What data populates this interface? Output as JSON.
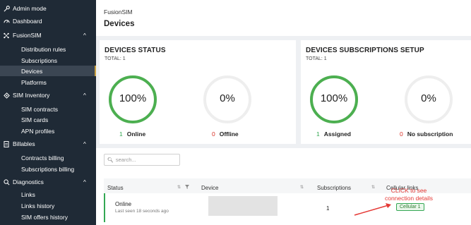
{
  "sidebar": {
    "items": [
      {
        "icon": "key-icon",
        "label": "Admin mode"
      },
      {
        "icon": "dashboard-icon",
        "label": "Dashboard"
      },
      {
        "icon": "network-icon",
        "label": "FusionSIM",
        "chevron": "^"
      },
      {
        "icon": "sim-inventory-icon",
        "label": "SIM Inventory",
        "chevron": "^"
      },
      {
        "icon": "billables-icon",
        "label": "Billables",
        "chevron": "^"
      },
      {
        "icon": "diagnostics-icon",
        "label": "Diagnostics",
        "chevron": "^"
      }
    ],
    "fusionsim_sub": [
      "Distribution rules",
      "Subscriptions",
      "Devices",
      "Platforms"
    ],
    "sim_inventory_sub": [
      "SIM contracts",
      "SIM cards",
      "APN profiles"
    ],
    "billables_sub": [
      "Contracts billing",
      "Subscriptions billing"
    ],
    "diagnostics_sub": [
      "Links",
      "Links history",
      "SIM offers history"
    ]
  },
  "header": {
    "breadcrumb": "FusionSIM",
    "title": "Devices"
  },
  "status_card": {
    "title": "DEVICES STATUS",
    "total": "TOTAL: 1",
    "ring_left": {
      "pct": "100%",
      "fraction": 1.0,
      "color": "#4caf50"
    },
    "ring_right": {
      "pct": "0%",
      "fraction": 0.0
    },
    "online_count": "1",
    "online_label": "Online",
    "offline_count": "0",
    "offline_label": "Offline"
  },
  "subs_card": {
    "title": "DEVICES SUBSCRIPTIONS SETUP",
    "total": "TOTAL: 1",
    "ring_left": {
      "pct": "100%",
      "fraction": 1.0,
      "color": "#4caf50"
    },
    "ring_right": {
      "pct": "0%",
      "fraction": 0.0
    },
    "assigned_count": "1",
    "assigned_label": "Assigned",
    "nosub_count": "0",
    "nosub_label": "No subscription"
  },
  "table": {
    "search_placeholder": "search...",
    "columns": [
      "Status",
      "Device",
      "Subscriptions",
      "Cellular links"
    ],
    "rows": [
      {
        "status": "Online",
        "last_seen": "Last seen 18 seconds ago",
        "subscriptions": "1",
        "link": "Cellular 1"
      }
    ]
  },
  "annotation": {
    "line1": "CLICK to see",
    "line2": "connection details",
    "color": "#e53935"
  }
}
